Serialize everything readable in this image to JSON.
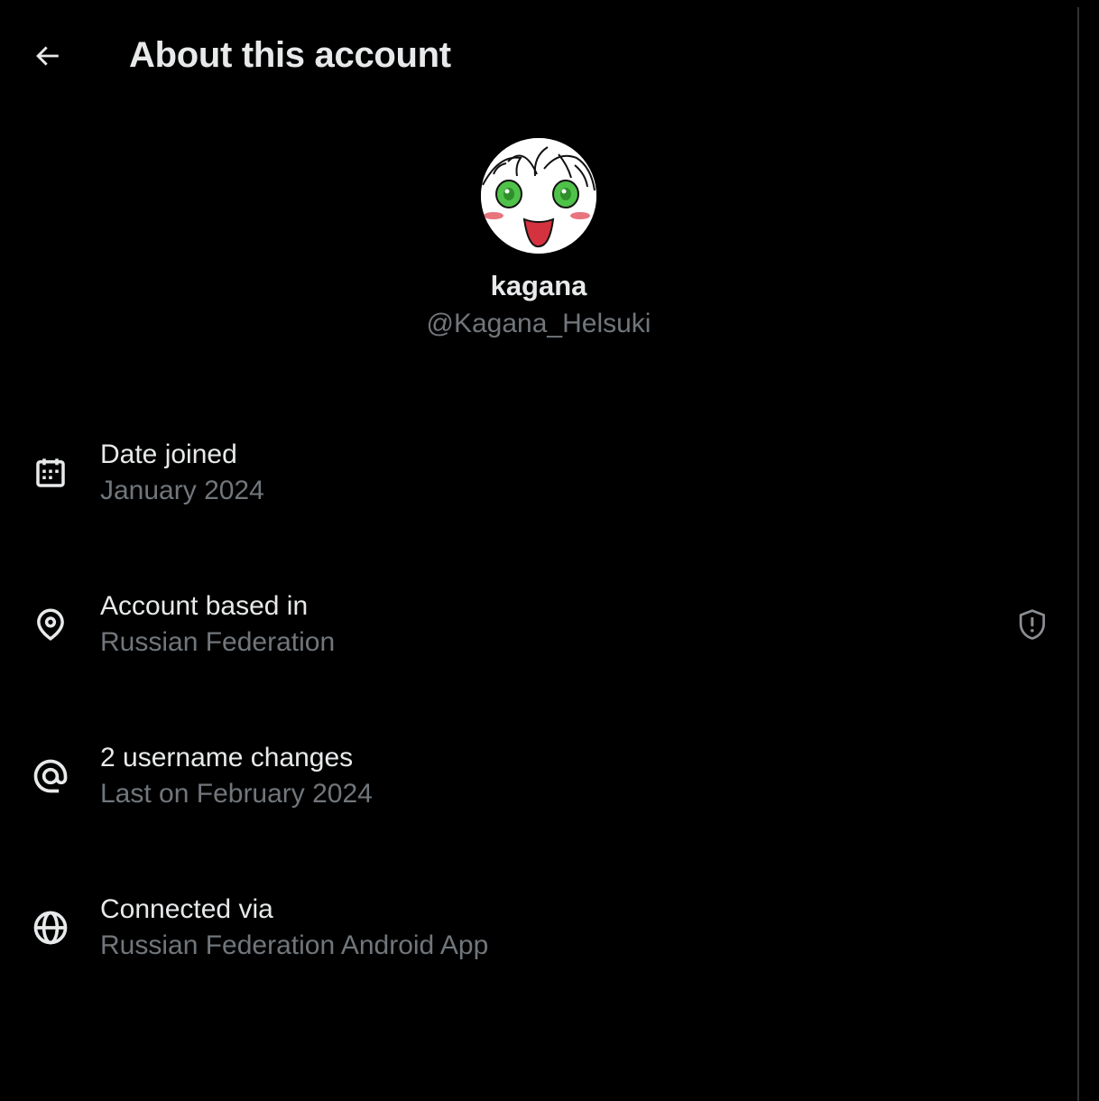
{
  "header": {
    "title": "About this account",
    "back_icon": "arrow-left-icon"
  },
  "profile": {
    "display_name": "kagana",
    "handle": "@Kagana_Helsuki"
  },
  "rows": [
    {
      "icon": "calendar-icon",
      "label": "Date joined",
      "value": "January 2024"
    },
    {
      "icon": "location-pin-icon",
      "label": "Account based in",
      "value": "Russian Federation",
      "trailing_icon": "shield-alert-icon"
    },
    {
      "icon": "at-sign-icon",
      "label": "2 username changes",
      "value": "Last on February 2024"
    },
    {
      "icon": "globe-icon",
      "label": "Connected via",
      "value": "Russian Federation Android App"
    }
  ],
  "colors": {
    "background": "#000000",
    "primary_text": "#e7e9ea",
    "secondary_text": "#71767b",
    "divider": "#2f3336"
  }
}
